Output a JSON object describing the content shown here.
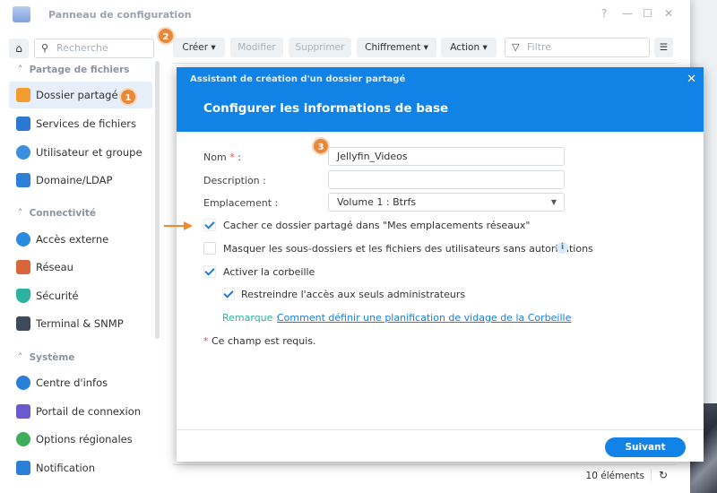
{
  "window": {
    "title": "Panneau de configuration",
    "help": "?",
    "minimize": "—",
    "maximize": "☐",
    "close": "✕"
  },
  "sidebar": {
    "search_placeholder": "Recherche",
    "sections": [
      {
        "label": "Partage de fichiers",
        "items": [
          "Dossier partagé",
          "Services de fichiers",
          "Utilisateur et groupe",
          "Domaine/LDAP"
        ]
      },
      {
        "label": "Connectivité",
        "items": [
          "Accès externe",
          "Réseau",
          "Sécurité",
          "Terminal & SNMP"
        ]
      },
      {
        "label": "Système",
        "items": [
          "Centre d'infos",
          "Portail de connexion",
          "Options régionales",
          "Notification"
        ]
      }
    ]
  },
  "toolbar": {
    "create": "Créer",
    "modify": "Modifier",
    "delete": "Supprimer",
    "encryption": "Chiffrement",
    "action": "Action",
    "filter_placeholder": "Filtre"
  },
  "badges": [
    "1",
    "2",
    "3"
  ],
  "footer": {
    "count": "10 éléments"
  },
  "dialog": {
    "subtitle": "Assistant de création d'un dossier partagé",
    "title": "Configurer les informations de base",
    "name_label": "Nom",
    "required_mark": "*",
    "colon": ":",
    "name_value": "Jellyfin_Videos",
    "description_label": "Description :",
    "description_value": "",
    "location_label": "Emplacement :",
    "location_value": "Volume 1 :  Btrfs",
    "hide_share": "Cacher ce dossier partagé dans \"Mes emplacements réseaux\"",
    "hide_subfolders": "Masquer les sous-dossiers et les fichiers des utilisateurs sans autorisations",
    "recycle": "Activer la corbeille",
    "restrict": "Restreindre l'accès aux seuls administrateurs",
    "note_label": "Remarque :",
    "note_link": "Comment définir une planification de vidage de la Corbeille",
    "required_note": "Ce champ est requis.",
    "next": "Suivant"
  },
  "colors": {
    "accent": "#1283e6",
    "badge": "#e8883a"
  }
}
